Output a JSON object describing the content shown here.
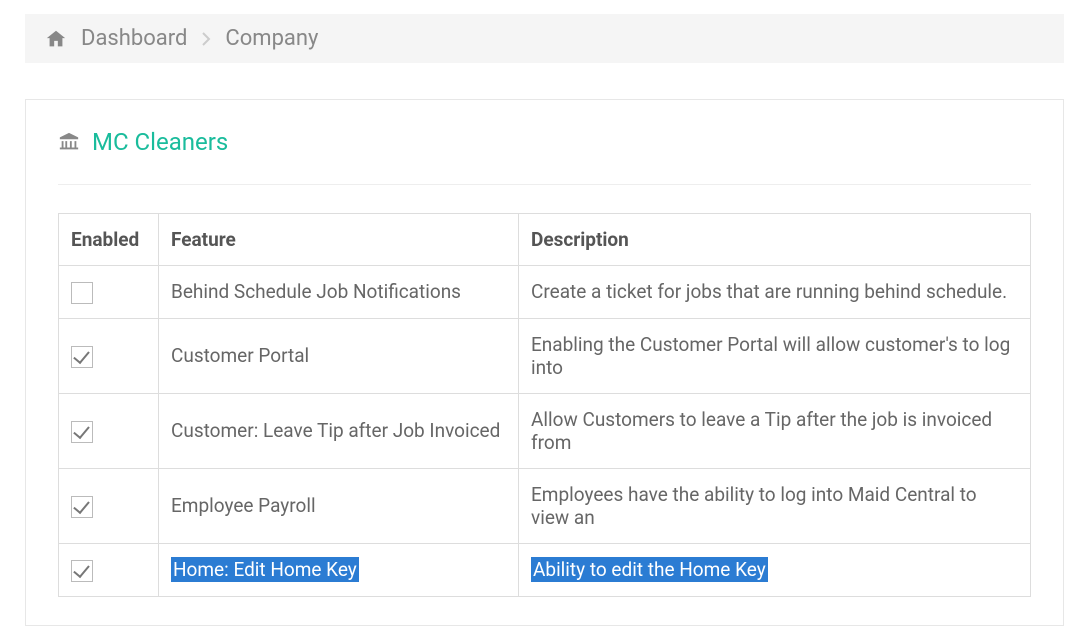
{
  "breadcrumb": {
    "dashboard": "Dashboard",
    "current": "Company"
  },
  "panel": {
    "title": "MC Cleaners"
  },
  "table": {
    "headers": {
      "enabled": "Enabled",
      "feature": "Feature",
      "description": "Description"
    },
    "rows": [
      {
        "enabled": false,
        "feature": "Behind Schedule Job Notifications",
        "description": "Create a ticket for jobs that are running behind schedule.",
        "highlighted": false
      },
      {
        "enabled": true,
        "feature": "Customer Portal",
        "description": "Enabling the Customer Portal will allow customer's to log into",
        "highlighted": false
      },
      {
        "enabled": true,
        "feature": "Customer: Leave Tip after Job Invoiced",
        "description": "Allow Customers to leave a Tip after the job is invoiced from",
        "highlighted": false
      },
      {
        "enabled": true,
        "feature": "Employee Payroll",
        "description": "Employees have the ability to log into Maid Central to view an",
        "highlighted": false
      },
      {
        "enabled": true,
        "feature": "Home: Edit Home Key",
        "description": "Ability to edit the Home Key",
        "highlighted": true
      }
    ]
  }
}
